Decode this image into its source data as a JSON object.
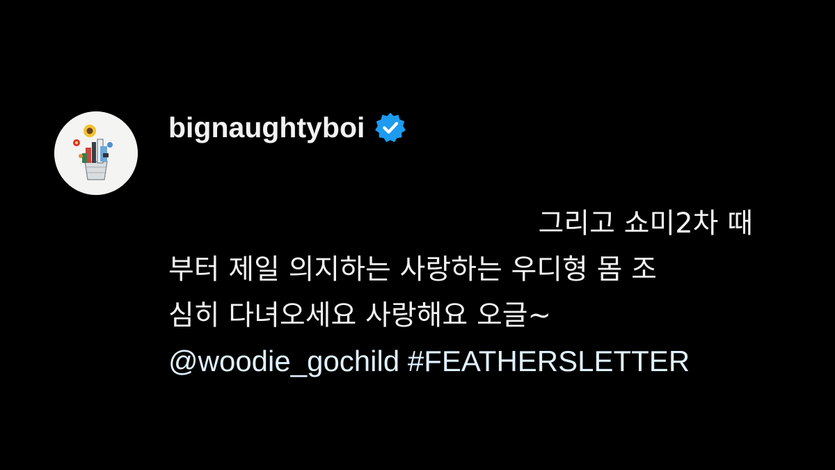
{
  "comment": {
    "username": "bignaughtyboi",
    "verified_icon": "verified-badge-icon",
    "avatar_icon": "flower-bucket-avatar",
    "accent_color": "#1d9bf0",
    "text_lines": [
      "그리고 쇼미2차 때",
      "부터 제일 의지하는 사랑하는 우디형 몸 조",
      "심히 다녀오세요 사랑해요 오글~"
    ],
    "mention": "@woodie_gochild",
    "hashtag": "#FEATHERSLETTER"
  }
}
